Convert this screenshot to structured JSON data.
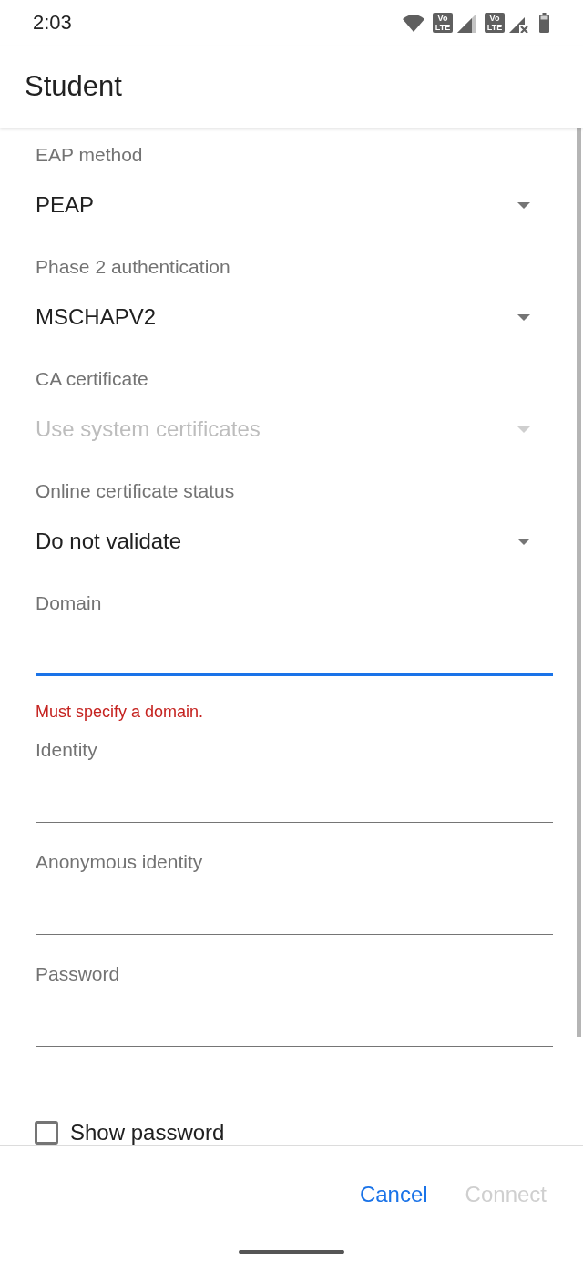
{
  "status_bar": {
    "time": "2:03",
    "sims": [
      {
        "badge_top": "Vo",
        "badge_bottom": "LTE",
        "no_service": false
      },
      {
        "badge_top": "Vo",
        "badge_bottom": "LTE",
        "no_service": true
      }
    ]
  },
  "dialog": {
    "title": "Student"
  },
  "fields": [
    {
      "kind": "dropdown",
      "label": "EAP method",
      "value": "PEAP",
      "disabled": false
    },
    {
      "kind": "dropdown",
      "label": "Phase 2 authentication",
      "value": "MSCHAPV2",
      "disabled": false
    },
    {
      "kind": "dropdown",
      "label": "CA certificate",
      "value": "Use system certificates",
      "disabled": true
    },
    {
      "kind": "dropdown",
      "label": "Online certificate status",
      "value": "Do not validate",
      "disabled": false
    },
    {
      "kind": "text",
      "label": "Domain",
      "focused": true,
      "error": "Must specify a domain."
    },
    {
      "kind": "text",
      "label": "Identity",
      "focused": false
    },
    {
      "kind": "text",
      "label": "Anonymous identity",
      "focused": false
    },
    {
      "kind": "text",
      "label": "Password",
      "focused": false
    }
  ],
  "show_password": {
    "label": "Show password",
    "checked": false
  },
  "buttons": [
    {
      "label": "Cancel",
      "disabled": false
    },
    {
      "label": "Connect",
      "disabled": true
    }
  ]
}
